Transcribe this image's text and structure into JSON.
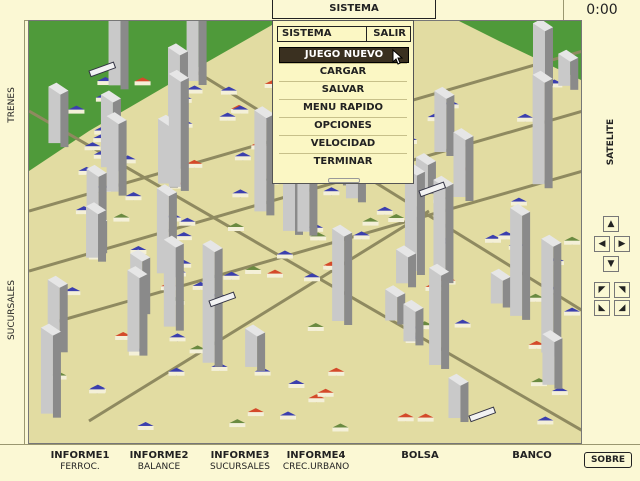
{
  "topbar": {
    "sistema_tab": "SISTEMA",
    "clock": "0:00"
  },
  "left_strip": {
    "trenes": "TRENES",
    "sucursales": "SUCURSALES"
  },
  "right_strip": {
    "satelite": "SATELITE"
  },
  "menu": {
    "header_left": "SISTEMA",
    "header_right": "SALIR",
    "selected_index": 0,
    "items": [
      "JUEGO NUEVO",
      "CARGAR",
      "SALVAR",
      "MENU RAPIDO",
      "OPCIONES",
      "VELOCIDAD",
      "TERMINAR"
    ]
  },
  "nav": {
    "scroll": [
      "▲",
      "◀",
      "▶",
      "▼"
    ],
    "rotate": [
      "◤",
      "◥",
      "◣",
      "◢"
    ]
  },
  "bottom_tabs": [
    {
      "title": "INFORME1",
      "sub": "FERROC."
    },
    {
      "title": "INFORME2",
      "sub": "BALANCE"
    },
    {
      "title": "INFORME3",
      "sub": "SUCURSALES"
    },
    {
      "title": "INFORME4",
      "sub": "CREC.URBANO"
    },
    {
      "title": "BOLSA",
      "sub": ""
    },
    {
      "title": "BANCO",
      "sub": ""
    }
  ],
  "sobre": "SOBRE",
  "colors": {
    "panel": "#fbf8d4",
    "grass": "#4f9a3a",
    "ground": "#e2dca2",
    "rail": "#8f8a60",
    "building": "#c9c9c9",
    "building_shade": "#8a8a8a",
    "roof_blue": "#3b3fae",
    "roof_red": "#d44a2a",
    "train": "#f2f2f2"
  }
}
